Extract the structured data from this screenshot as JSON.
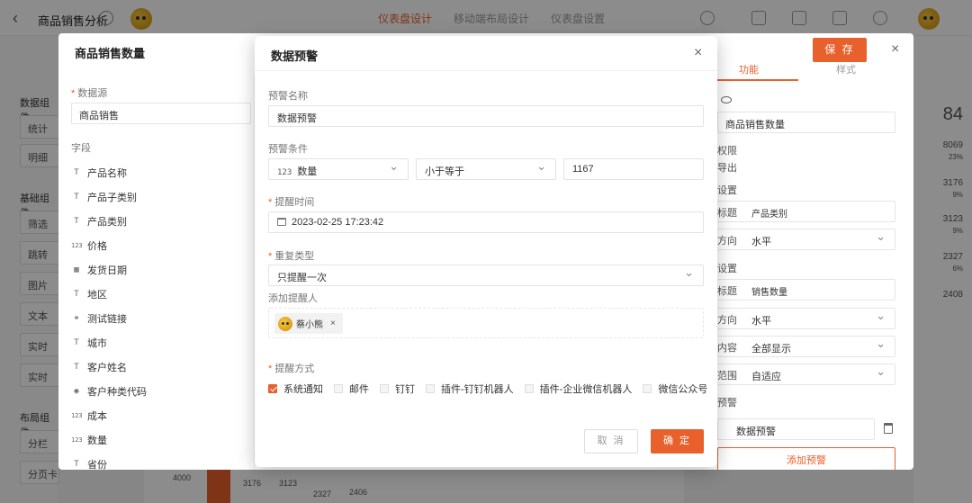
{
  "topbar": {
    "app_title": "商品销售分析",
    "tabs": [
      "仪表盘设计",
      "移动端布局设计",
      "仪表盘设置"
    ]
  },
  "background": {
    "left_sections": [
      "数据组件",
      "基础组件",
      "布局组件"
    ],
    "left_buttons": [
      "统计",
      "明细",
      "筛选",
      "跳转",
      "图片",
      "文本",
      "实时",
      "实时",
      "分栏",
      "分页卡"
    ],
    "right_numbers": [
      "84",
      "8069",
      "23%",
      "3176",
      "9%",
      "3123",
      "9%",
      "2327",
      "6%",
      "2408"
    ],
    "bottom_numbers": [
      "4000",
      "3176",
      "3123",
      "2327",
      "2406"
    ]
  },
  "drawer": {
    "title": "商品销售数量",
    "save_label": "保 存",
    "data_source_label": "数据源",
    "data_source_value": "商品销售",
    "fields_label": "字段",
    "fields": [
      {
        "icon": "text-field-icon",
        "glyph": "T",
        "label": "产品名称"
      },
      {
        "icon": "text-field-icon",
        "glyph": "T",
        "label": "产品子类别"
      },
      {
        "icon": "text-field-icon",
        "glyph": "T",
        "label": "产品类别"
      },
      {
        "icon": "number-field-icon",
        "glyph": "123",
        "label": "价格"
      },
      {
        "icon": "date-field-icon",
        "glyph": "▦",
        "label": "发货日期"
      },
      {
        "icon": "text-field-icon",
        "glyph": "T",
        "label": "地区"
      },
      {
        "icon": "link-field-icon",
        "glyph": "⚭",
        "label": "测试链接"
      },
      {
        "icon": "text-field-icon",
        "glyph": "T",
        "label": "城市"
      },
      {
        "icon": "text-field-icon",
        "glyph": "T",
        "label": "客户姓名"
      },
      {
        "icon": "code-field-icon",
        "glyph": "◉",
        "label": "客户种类代码"
      },
      {
        "icon": "number-field-icon",
        "glyph": "123",
        "label": "成本"
      },
      {
        "icon": "number-field-icon",
        "glyph": "123",
        "label": "数量"
      },
      {
        "icon": "text-field-icon",
        "glyph": "T",
        "label": "省份"
      }
    ],
    "right": {
      "tabs": [
        "功能",
        "样式"
      ],
      "name_value": "商品销售数量",
      "permission_label": "权限",
      "export_label": "导出",
      "x_setting_label": "设置",
      "x_title_label": "标题",
      "x_title_value": "产品类别",
      "x_direction_label": "方向",
      "x_direction_value": "水平",
      "y_setting_label": "设置",
      "y_title_label": "标题",
      "y_title_value": "销售数量",
      "y_direction_label": "方向",
      "y_direction_value": "水平",
      "content_label": "内容",
      "content_value": "全部显示",
      "range_label": "范围",
      "range_value": "自适应",
      "warning_label": "预警",
      "warning_item": "数据预警",
      "add_warning": "添加预警"
    }
  },
  "modal": {
    "title": "数据预警",
    "name_label": "预警名称",
    "name_value": "数据预警",
    "condition_label": "预警条件",
    "condition_field": "数量",
    "condition_operator": "小于等于",
    "condition_value": "1167",
    "remind_time_label": "提醒时间",
    "remind_time_value": "2023-02-25 17:23:42",
    "repeat_label": "重复类型",
    "repeat_value": "只提醒一次",
    "recipients_label": "添加提醒人",
    "recipient_name": "蔡小熊",
    "method_label": "提醒方式",
    "methods": [
      {
        "label": "系统通知",
        "checked": true
      },
      {
        "label": "邮件",
        "checked": false
      },
      {
        "label": "钉钉",
        "checked": false
      },
      {
        "label": "插件-钉钉机器人",
        "checked": false
      },
      {
        "label": "插件-企业微信机器人",
        "checked": false
      },
      {
        "label": "微信公众号",
        "checked": false
      }
    ],
    "cancel_label": "取 消",
    "ok_label": "确 定"
  }
}
